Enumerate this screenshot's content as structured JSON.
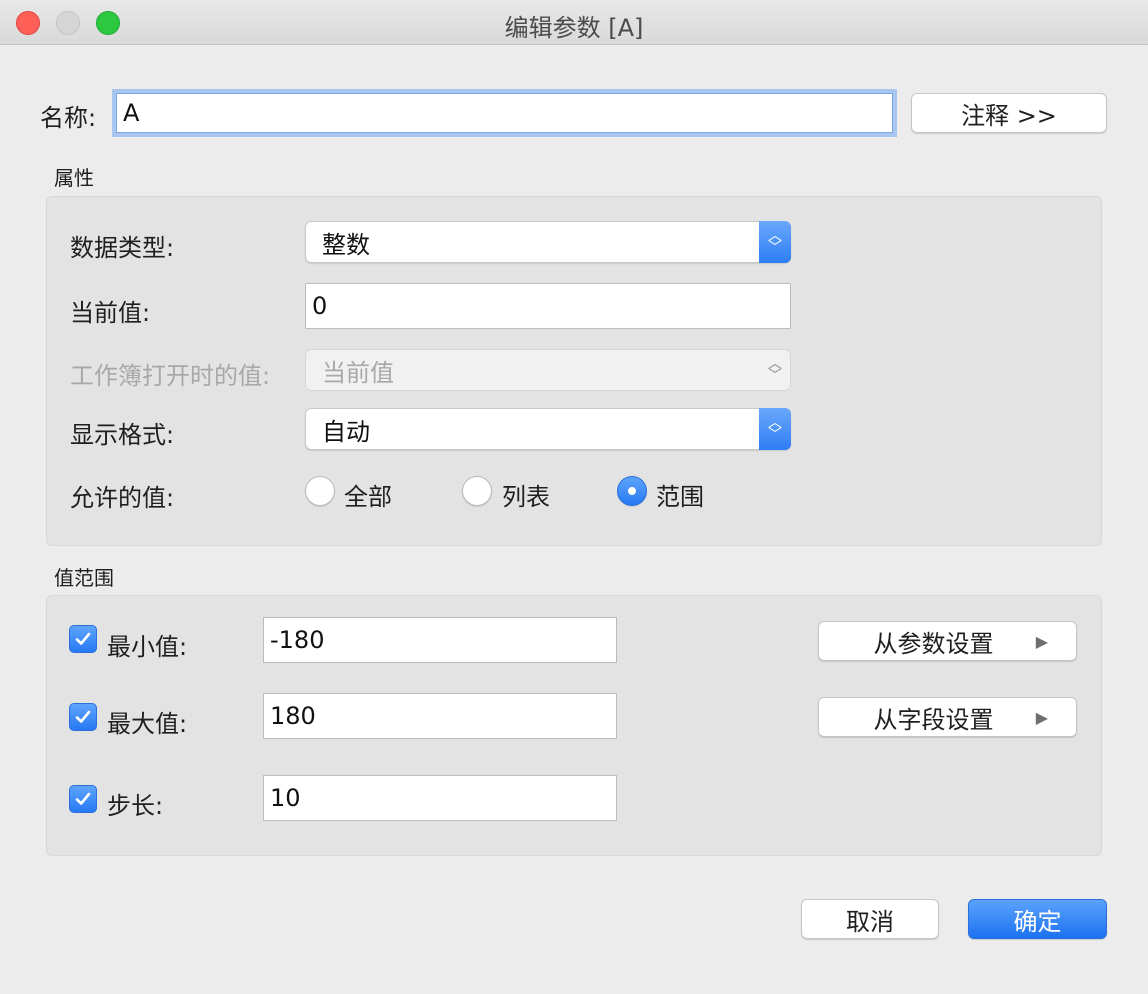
{
  "window": {
    "title": "编辑参数 [A]"
  },
  "name_row": {
    "label": "名称:",
    "value": "A",
    "comment_button": "注释 >>"
  },
  "properties": {
    "section_title": "属性",
    "data_type": {
      "label": "数据类型:",
      "value": "整数"
    },
    "current_value": {
      "label": "当前值:",
      "value": "0"
    },
    "workbook_open_value": {
      "label": "工作簿打开时的值:",
      "value": "当前值"
    },
    "display_format": {
      "label": "显示格式:",
      "value": "自动"
    },
    "allowed_values": {
      "label": "允许的值:",
      "options": [
        "全部",
        "列表",
        "范围"
      ],
      "selected": "范围"
    }
  },
  "range": {
    "section_title": "值范围",
    "min": {
      "label": "最小值:",
      "value": "-180",
      "checked": true
    },
    "max": {
      "label": "最大值:",
      "value": "180",
      "checked": true
    },
    "step": {
      "label": "步长:",
      "value": "10",
      "checked": true
    },
    "from_param_button": "从参数设置",
    "from_field_button": "从字段设置"
  },
  "footer": {
    "cancel": "取消",
    "ok": "确定"
  },
  "colors": {
    "accent": "#2f7ef5",
    "window_bg": "#ececec",
    "panel_bg": "#e3e3e3"
  },
  "icons": {
    "dropdown": "updown-chevron-icon",
    "submenu": "triangle-right-icon",
    "check": "checkmark-icon"
  }
}
